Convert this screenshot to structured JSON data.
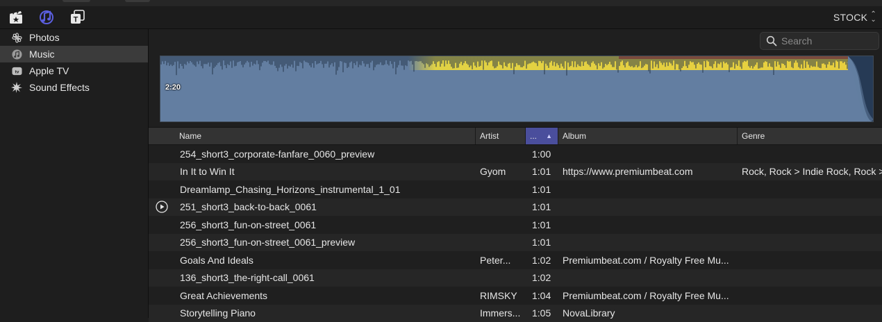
{
  "toolbar": {
    "icons": [
      "photos-and-video-icon",
      "music-and-sound-icon",
      "titles-and-generators-icon"
    ],
    "source_label": "STOCK"
  },
  "sidebar": {
    "items": [
      {
        "label": "Photos",
        "icon": "photos-icon",
        "selected": false
      },
      {
        "label": "Music",
        "icon": "music-icon",
        "selected": true
      },
      {
        "label": "Apple TV",
        "icon": "apple-tv-icon",
        "selected": false
      },
      {
        "label": "Sound Effects",
        "icon": "sound-effects-icon",
        "selected": false
      }
    ]
  },
  "search": {
    "placeholder": "Search",
    "value": ""
  },
  "preview": {
    "duration": "2:20"
  },
  "table": {
    "columns": {
      "name": "Name",
      "artist": "Artist",
      "duration": "...",
      "album": "Album",
      "genre": "Genre"
    },
    "sorted_column": "duration",
    "rows": [
      {
        "name": "254_short3_corporate-fanfare_0060_preview",
        "artist": "",
        "duration": "1:00",
        "album": "",
        "genre": ""
      },
      {
        "name": "In It to Win It",
        "artist": "Gyom",
        "duration": "1:01",
        "album": "https://www.premiumbeat.com",
        "genre": "Rock, Rock > Indie Rock, Rock >"
      },
      {
        "name": "Dreamlamp_Chasing_Horizons_instrumental_1_01",
        "artist": "",
        "duration": "1:01",
        "album": "",
        "genre": ""
      },
      {
        "name": "251_short3_back-to-back_0061",
        "artist": "",
        "duration": "1:01",
        "album": "",
        "genre": "",
        "hover": true
      },
      {
        "name": "256_short3_fun-on-street_0061",
        "artist": "",
        "duration": "1:01",
        "album": "",
        "genre": ""
      },
      {
        "name": "256_short3_fun-on-street_0061_preview",
        "artist": "",
        "duration": "1:01",
        "album": "",
        "genre": ""
      },
      {
        "name": "Goals And Ideals",
        "artist": "Peter...",
        "duration": "1:02",
        "album": "Premiumbeat.com / Royalty Free Mu...",
        "genre": ""
      },
      {
        "name": "136_short3_the-right-call_0061",
        "artist": "",
        "duration": "1:02",
        "album": "",
        "genre": ""
      },
      {
        "name": "Great Achievements",
        "artist": "RIMSKY",
        "duration": "1:04",
        "album": "Premiumbeat.com / Royalty Free Mu...",
        "genre": ""
      },
      {
        "name": "Storytelling Piano",
        "artist": "Immers...",
        "duration": "1:05",
        "album": "NovaLibrary",
        "genre": ""
      }
    ]
  }
}
